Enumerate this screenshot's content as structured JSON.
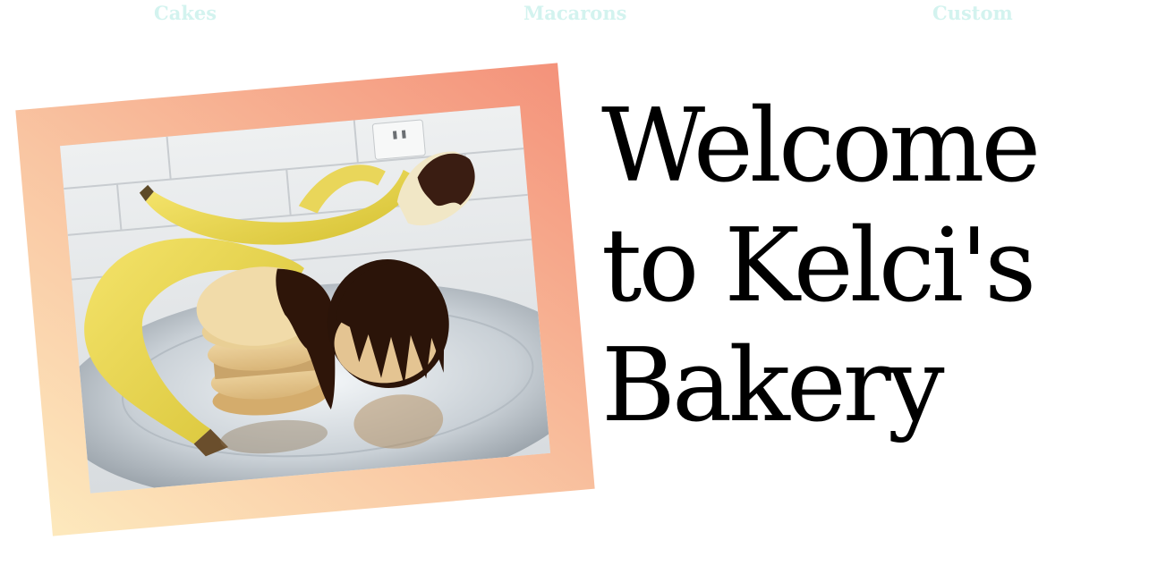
{
  "nav": {
    "items": [
      {
        "label": "Cakes"
      },
      {
        "label": "Macarons"
      },
      {
        "label": "Custom"
      }
    ]
  },
  "hero": {
    "title_lines": [
      "Welcome",
      "to Kelci's",
      "Bakery"
    ]
  },
  "colors": {
    "nav_text": "#d3f3ef",
    "frame_gradient_start": "#fde9bd",
    "frame_gradient_end": "#f4927a",
    "title": "#000000"
  }
}
